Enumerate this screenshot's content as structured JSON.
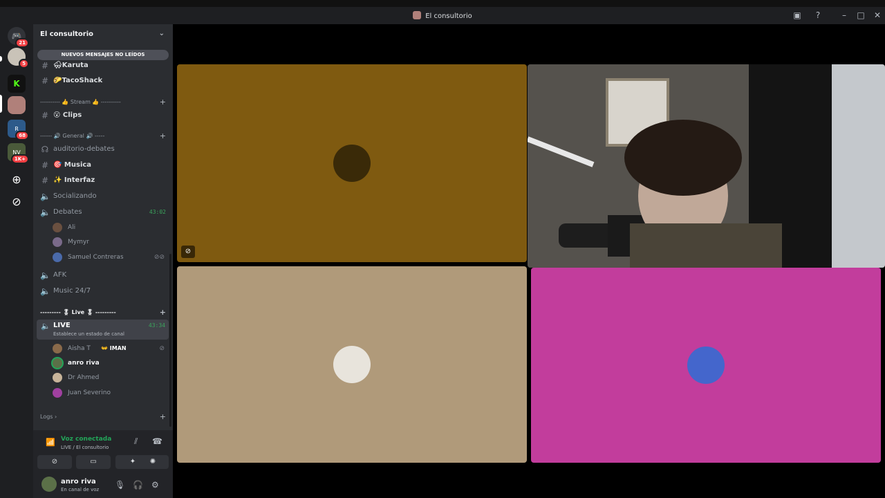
{
  "window": {
    "title": "El consultorio"
  },
  "rail": {
    "badges": [
      "21",
      "5",
      "68",
      "1K+"
    ]
  },
  "sidebar": {
    "server_name": "El consultorio",
    "unread_banner": "NUEVOS MENSAJES NO LEÍDOS",
    "channels_top": [
      {
        "name": "🌨Karuta"
      },
      {
        "name": "🌮TacoShack"
      }
    ],
    "cat_stream": "---------- 👍 Stream 👍 ----------",
    "clips": "😮 Clips",
    "cat_general": "------ 🔊 General 🔊 -----",
    "channels_general": [
      {
        "name": "auditorio-debates",
        "type": "stage"
      },
      {
        "name": "🎯 Musica",
        "type": "text"
      },
      {
        "name": "✨ Interfaz",
        "type": "text"
      },
      {
        "name": "Socializando",
        "type": "voice"
      },
      {
        "name": "Debates",
        "type": "voice",
        "time": "43:02"
      }
    ],
    "debates_users": [
      "Ali",
      "Mymyr",
      "Samuel Contreras"
    ],
    "afk": "AFK",
    "music": "Music 24/7",
    "cat_live": "--------- 🎖 Live 🎖 ---------",
    "live_channel": {
      "name": "LIVE",
      "status": "Establece un estado de canal",
      "time": "43:34"
    },
    "live_users": [
      {
        "name": "Aisha T",
        "tag": "👐 IMAN"
      },
      {
        "name": "anro riva"
      },
      {
        "name": "Dr Ahmed"
      },
      {
        "name": "Juan Severino"
      }
    ],
    "logs": "Logs"
  },
  "voice": {
    "status": "Voz conectada",
    "location": "LIVE / El consultorio"
  },
  "user_panel": {
    "name": "anro riva",
    "status": "En canal de voz"
  },
  "tiles": [
    {
      "id": "sunflower",
      "bg": "#7f5a10",
      "avatar_color": "#3a2a08"
    },
    {
      "id": "webcam",
      "bg": "#2a2a2a"
    },
    {
      "id": "ahmed",
      "bg": "#b09a7a",
      "avatar_color": "#e8e4dc"
    },
    {
      "id": "juan",
      "bg": "#c23d9c",
      "avatar_color": "#4466cc"
    }
  ],
  "colors": {
    "accent_green": "#23a559",
    "danger": "#f23f43"
  }
}
